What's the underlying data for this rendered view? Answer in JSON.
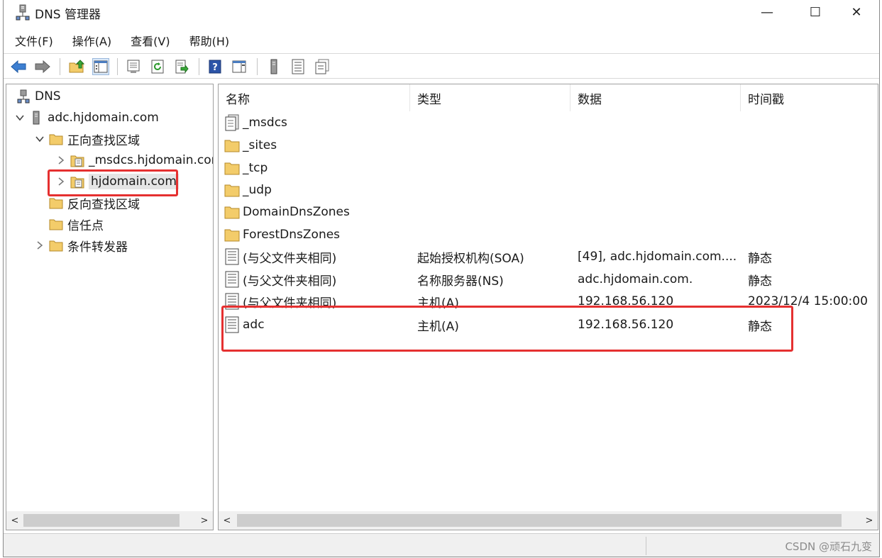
{
  "window": {
    "title": "DNS 管理器",
    "minimize": "—",
    "maximize": "☐",
    "close": "✕"
  },
  "menu": [
    "文件(F)",
    "操作(A)",
    "查看(V)",
    "帮助(H)"
  ],
  "toolbar": [
    "back-icon",
    "forward-icon",
    "up-folder-icon",
    "show-tree-icon",
    "properties-icon",
    "refresh-icon",
    "export-icon",
    "help-icon",
    "action-pane-icon",
    "server-icon",
    "zone-icon",
    "zone-copy-icon"
  ],
  "tree": {
    "root": "DNS",
    "server": "adc.hjdomain.com",
    "forward_zones": "正向查找区域",
    "msdcs_zone": "_msdcs.hjdomain.com",
    "hjdomain_zone": "hjdomain.com",
    "reverse_zones": "反向查找区域",
    "trust_points": "信任点",
    "conditional_forwarders": "条件转发器"
  },
  "list": {
    "columns": {
      "name": "名称",
      "type": "类型",
      "data": "数据",
      "timestamp": "时间戳"
    },
    "rows": [
      {
        "name": "_msdcs",
        "type": "",
        "data": "",
        "timestamp": "",
        "icon": "delegated-zone-icon"
      },
      {
        "name": "_sites",
        "type": "",
        "data": "",
        "timestamp": "",
        "icon": "folder-icon"
      },
      {
        "name": "_tcp",
        "type": "",
        "data": "",
        "timestamp": "",
        "icon": "folder-icon"
      },
      {
        "name": "_udp",
        "type": "",
        "data": "",
        "timestamp": "",
        "icon": "folder-icon"
      },
      {
        "name": "DomainDnsZones",
        "type": "",
        "data": "",
        "timestamp": "",
        "icon": "folder-icon"
      },
      {
        "name": "ForestDnsZones",
        "type": "",
        "data": "",
        "timestamp": "",
        "icon": "folder-icon"
      },
      {
        "name": "(与父文件夹相同)",
        "type": "起始授权机构(SOA)",
        "data": "[49], adc.hjdomain.com....",
        "timestamp": "静态",
        "icon": "record-icon"
      },
      {
        "name": "(与父文件夹相同)",
        "type": "名称服务器(NS)",
        "data": "adc.hjdomain.com.",
        "timestamp": "静态",
        "icon": "record-icon"
      },
      {
        "name": "(与父文件夹相同)",
        "type": "主机(A)",
        "data": "192.168.56.120",
        "timestamp": "2023/12/4 15:00:00",
        "icon": "record-icon"
      },
      {
        "name": "adc",
        "type": "主机(A)",
        "data": "192.168.56.120",
        "timestamp": "静态",
        "icon": "record-icon"
      }
    ]
  },
  "scroll": {
    "left": "<",
    "right": ">"
  },
  "watermark": "CSDN @顽石九变",
  "colors": {
    "highlight": "#e53030",
    "selection": "#e5e5e5",
    "folder": "#f3cc6a"
  }
}
